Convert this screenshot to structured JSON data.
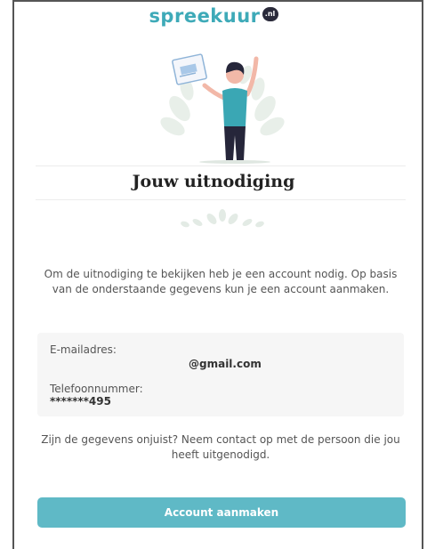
{
  "brand": {
    "name": "spreekuur",
    "badge": ".nl",
    "color": "#3eaab8"
  },
  "page": {
    "title": "Jouw uitnodiging",
    "intro": "Om de uitnodiging te bekijken heb je een account nodig. Op basis van de onderstaande gegevens kun je een account aanmaken.",
    "help": "Zijn de gegevens onjuist? Neem contact op met de persoon die jou heeft uitgenodigd."
  },
  "details": {
    "email_label": "E-mailadres:",
    "email_value": "@gmail.com",
    "phone_label": "Telefoonnummer:",
    "phone_value": "*******495"
  },
  "actions": {
    "create_account": "Account aanmaken",
    "button_color": "#5fb9c6"
  },
  "icons": {
    "hero": "woman-holding-invitation-illustration",
    "ornament": "leaf-ornament"
  }
}
